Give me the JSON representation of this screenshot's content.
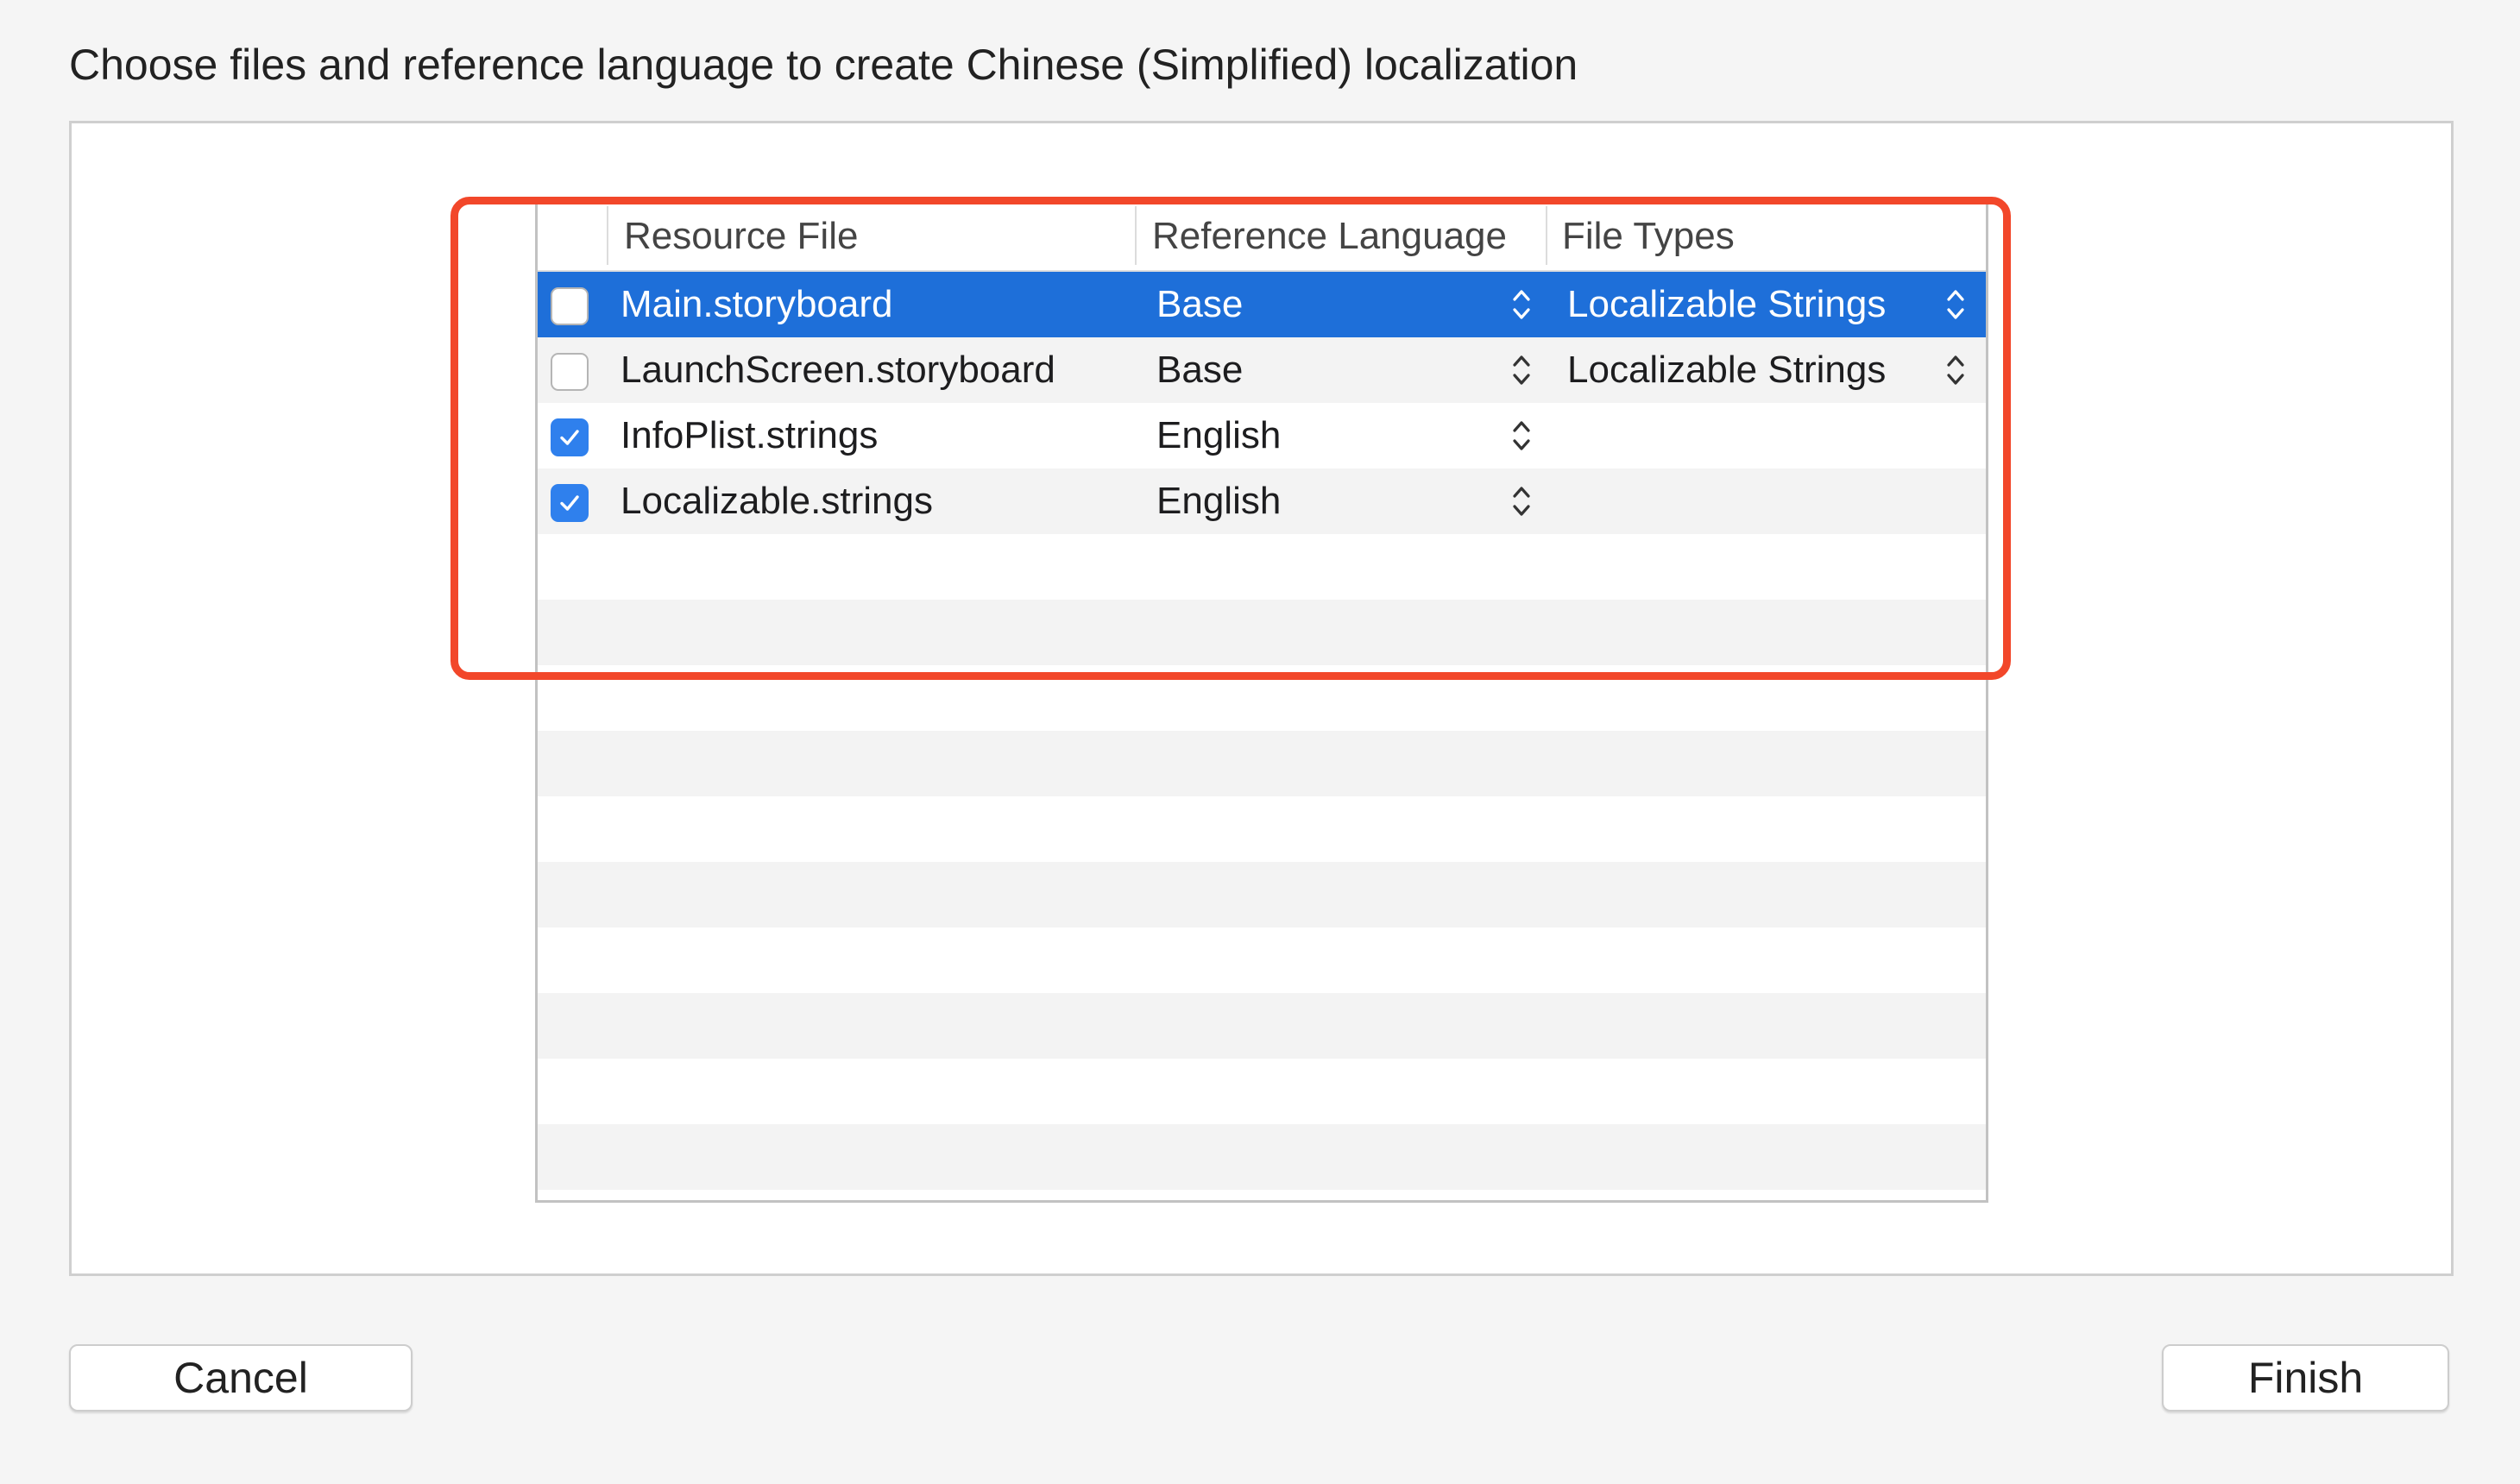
{
  "dialog": {
    "title": "Choose files and reference language to create Chinese (Simplified) localization"
  },
  "table": {
    "columns": [
      "Resource File",
      "Reference Language",
      "File Types"
    ],
    "rows": [
      {
        "checked": false,
        "file": "Main.storyboard",
        "language": "Base",
        "file_type": "Localizable Strings",
        "selected": true
      },
      {
        "checked": false,
        "file": "LaunchScreen.storyboard",
        "language": "Base",
        "file_type": "Localizable Strings",
        "selected": false
      },
      {
        "checked": true,
        "file": "InfoPlist.strings",
        "language": "English",
        "file_type": "",
        "selected": false
      },
      {
        "checked": true,
        "file": "Localizable.strings",
        "language": "English",
        "file_type": "",
        "selected": false
      }
    ]
  },
  "buttons": {
    "cancel": "Cancel",
    "finish": "Finish"
  },
  "colors": {
    "selection": "#1e6fd9",
    "checkbox_on": "#2f80ed",
    "highlight_box": "#f2472a"
  }
}
